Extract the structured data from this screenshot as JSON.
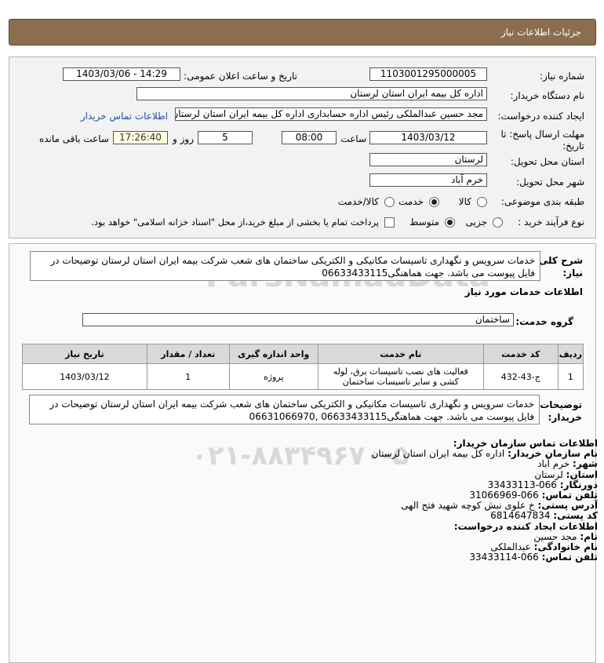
{
  "header": {
    "title": "جزئیات اطلاعات نیاز"
  },
  "fields": {
    "need_number_label": "شماره نیاز:",
    "need_number": "1103001295000005",
    "announce_label": "تاریخ و ساعت اعلان عمومی:",
    "announce_value": "1403/03/06 - 14:29",
    "buyer_org_label": "نام دستگاه خریدار:",
    "buyer_org": "اداره کل بیمه ایران استان لرستان",
    "creator_label": "ایجاد کننده درخواست:",
    "creator": "مجد حسین  عبدالملکی  رئیس اداره حسابداری  اداره کل بیمه ایران استان لرستان",
    "contact_link": "اطلاعات تماس خریدار",
    "deadline_label_1": "مهلت ارسال پاسخ: تا",
    "deadline_label_2": "تاریخ:",
    "deadline_date": "1403/03/12",
    "time_label": "ساعت",
    "deadline_time": "08:00",
    "days_value": "5",
    "days_label": "روز و",
    "remaining_time": "17:26:40",
    "remaining_label": "ساعت باقی مانده",
    "province_label": "استان محل تحویل:",
    "province": "لرستان",
    "city_label": "شهر محل تحویل:",
    "city": "خرم آباد",
    "category_label": "طبقه بندی موضوعی:",
    "category_options": [
      "کالا",
      "خدمت",
      "کالا/خدمت"
    ],
    "process_label": "نوع فرآیند خرید :",
    "process_options": [
      "جزیی",
      "متوسط"
    ],
    "payment_note": "پرداخت تمام یا بخشی از مبلغ خرید،از محل \"اسناد خزانه اسلامی\" خواهد بود."
  },
  "summary": {
    "label_1": "شرح کلی",
    "label_2": "نیاز:",
    "text": "خدمات سرویس و نگهداری تاسیسات مکانیکی و الکتریکی ساختمان های شعب شرکت بیمه ایران استان لرستان توضیحات در فایل پیوست می باشد. جهت هماهنگی06633433115"
  },
  "services": {
    "title": "اطلاعات خدمات مورد نیاز",
    "group_label": "گروه خدمت:",
    "group_value": "ساختمان",
    "columns": [
      "ردیف",
      "کد خدمت",
      "نام خدمت",
      "واحد اندازه گیری",
      "تعداد / مقدار",
      "تاریخ نیاز"
    ],
    "rows": [
      {
        "row": "1",
        "code": "ج-43-432",
        "name": "فعالیت های نصب تاسیسات برق، لوله کشی و سایر تاسیسات ساختمان",
        "unit": "پروژه",
        "qty": "1",
        "date": "1403/03/12"
      }
    ]
  },
  "buyer_notes": {
    "label_1": "توضیحات",
    "label_2": "خریدار:",
    "text": "خدمات سرویس و نگهداری تاسیسات مکانیکی و الکتریکی ساختمان های شعب شرکت بیمه ایران استان لرستان توضیحات در فایل پیوست می باشد. جهت هماهنگی06633433115 ,06631066970"
  },
  "contact": {
    "title": "اطلاعات تماس سازمان خریدار:",
    "lines": [
      {
        "k": "نام سازمان خریدار:",
        "v": "اداره کل بیمه ایران استان لرستان"
      },
      {
        "k": "شهر:",
        "v": "خرم آباد"
      },
      {
        "k": "استان:",
        "v": "لرستان"
      },
      {
        "k": "دورنگار:",
        "v": "066-33433113"
      },
      {
        "k": "تلفن تماس:",
        "v": "066-31066969"
      },
      {
        "k": "آدرس پستی:",
        "v": "خ علوی نبش کوچه شهید فتح الهی"
      },
      {
        "k": "کد پستی:",
        "v": "6814647834"
      }
    ],
    "creator_title": "اطلاعات ایجاد کننده درخواست:",
    "creator_lines": [
      {
        "k": "نام:",
        "v": "مجد حسین"
      },
      {
        "k": "نام خانوادگی:",
        "v": "عبدالملکی"
      },
      {
        "k": "تلفن تماس:",
        "v": "066-33433114"
      }
    ]
  },
  "watermark": {
    "brand": "ParsNamadData",
    "phone": "۰۲۱-۸۸۳۴۹۶۷۰-۵"
  }
}
